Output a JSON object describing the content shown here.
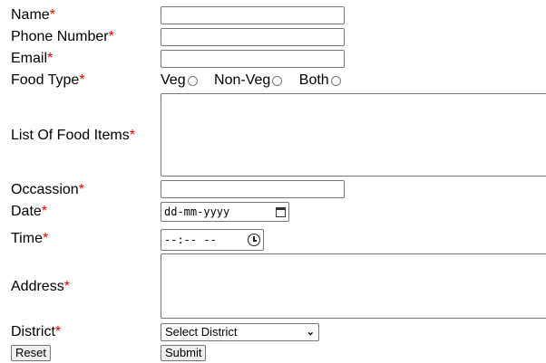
{
  "form": {
    "name": {
      "label": "Name",
      "required": "*",
      "value": ""
    },
    "phone": {
      "label": "Phone Number",
      "required": "*",
      "value": ""
    },
    "email": {
      "label": "Email",
      "required": "*",
      "value": ""
    },
    "food_type": {
      "label": "Food Type",
      "required": "*",
      "options": [
        "Veg",
        "Non-Veg",
        "Both"
      ]
    },
    "food_items": {
      "label": "List Of Food Items",
      "required": "*",
      "value": ""
    },
    "occasion": {
      "label": "Occassion",
      "required": "*",
      "value": ""
    },
    "date": {
      "label": "Date",
      "required": "*",
      "placeholder": "dd-mm-yyyy"
    },
    "time": {
      "label": "Time",
      "required": "*",
      "placeholder": "--:-- --"
    },
    "address": {
      "label": "Address",
      "required": "*",
      "value": ""
    },
    "district": {
      "label": "District",
      "required": "*",
      "selected": "Select District"
    },
    "buttons": {
      "reset": "Reset",
      "submit": "Submit"
    }
  },
  "colors": {
    "required": "#e00000",
    "border": "#767676",
    "button_bg": "#efefef"
  },
  "icons": {
    "date": "calendar-icon",
    "time": "clock-icon",
    "select": "chevron-down-icon"
  }
}
